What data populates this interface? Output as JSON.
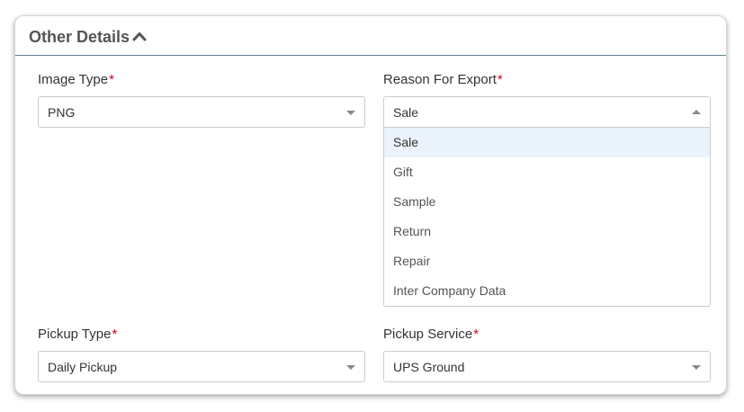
{
  "panel": {
    "title": "Other Details"
  },
  "fields": {
    "image_type": {
      "label": "Image Type",
      "required_mark": "*",
      "value": "PNG"
    },
    "reason_for_export": {
      "label": "Reason For Export",
      "required_mark": "*",
      "value": "Sale",
      "options": [
        "Sale",
        "Gift",
        "Sample",
        "Return",
        "Repair",
        "Inter Company Data"
      ]
    },
    "pickup_type": {
      "label": "Pickup Type",
      "required_mark": "*",
      "value": "Daily Pickup"
    },
    "pickup_service": {
      "label": "Pickup Service",
      "required_mark": "*",
      "value": "UPS Ground"
    }
  },
  "colors": {
    "required": "#d0021b",
    "highlight": "#eaf2fb",
    "header_rule": "#5e7f93"
  },
  "icons": {
    "collapse": "chevron-up-icon",
    "select_closed": "caret-down-icon",
    "select_open": "caret-up-icon"
  }
}
